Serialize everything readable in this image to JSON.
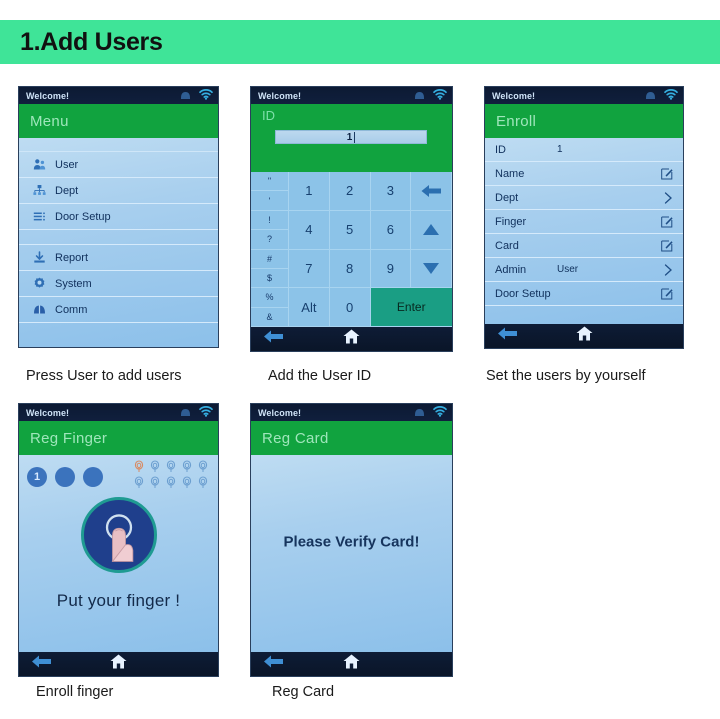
{
  "header": {
    "title": "1.Add Users",
    "banner_color": "#3fe498"
  },
  "common": {
    "statusbar_welcome": "Welcome!",
    "network_icon": "network-icon",
    "wifi_icon": "wifi-icon",
    "back_icon": "back-arrow-icon",
    "home_icon": "home-icon"
  },
  "devices": [
    {
      "id": "menu",
      "statusbar": "Welcome!",
      "title": "Menu",
      "menu_items": [
        {
          "label": "User",
          "icon": "user-icon"
        },
        {
          "label": "Dept",
          "icon": "department-icon"
        },
        {
          "label": "Door Setup",
          "icon": "list-icon"
        },
        {
          "label": "Report",
          "icon": "download-icon"
        },
        {
          "label": "System",
          "icon": "gear-icon"
        },
        {
          "label": "Comm",
          "icon": "comm-icon"
        }
      ],
      "caption": "Press User to add users"
    },
    {
      "id": "keypad",
      "statusbar": "Welcome!",
      "title": "ID",
      "input_value": "1",
      "symbols": [
        "\"",
        "'",
        "!",
        "?",
        "#",
        "$",
        "%",
        "&"
      ],
      "keys": [
        "1",
        "2",
        "3",
        "back",
        "4",
        "5",
        "6",
        "up",
        "7",
        "8",
        "9",
        "down",
        "Alt",
        "0",
        "Enter"
      ],
      "alt_label": "Alt",
      "enter_label": "Enter",
      "enter_color": "#1a9e84",
      "caption": "Add the User ID"
    },
    {
      "id": "enroll",
      "statusbar": "Welcome!",
      "title": "Enroll",
      "rows": [
        {
          "label": "ID",
          "value": "1",
          "action": "none"
        },
        {
          "label": "Name",
          "value": "",
          "action": "edit"
        },
        {
          "label": "Dept",
          "value": "",
          "action": "chevron"
        },
        {
          "label": "Finger",
          "value": "",
          "action": "edit"
        },
        {
          "label": "Card",
          "value": "",
          "action": "edit"
        },
        {
          "label": "Admin",
          "value": "User",
          "action": "chevron"
        },
        {
          "label": "Door Setup",
          "value": "",
          "action": "edit"
        }
      ],
      "caption": "Set the users by yourself"
    },
    {
      "id": "regfinger",
      "statusbar": "Welcome!",
      "title": "Reg Finger",
      "step_dots": [
        "1",
        "",
        ""
      ],
      "fingerprint_slots": 10,
      "message": "Put your finger !",
      "caption": "Enroll finger"
    },
    {
      "id": "regcard",
      "statusbar": "Welcome!",
      "title": "Reg Card",
      "message": "Please Verify Card!",
      "caption": "Reg Card"
    }
  ]
}
